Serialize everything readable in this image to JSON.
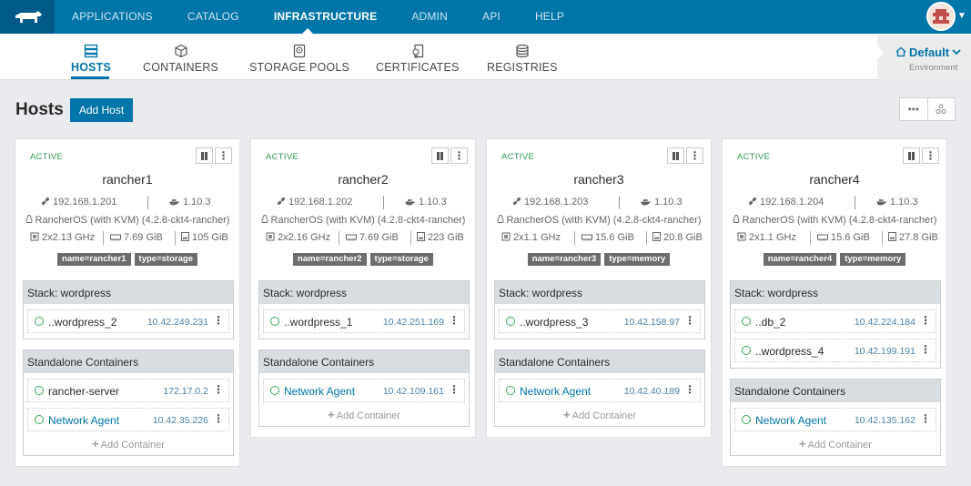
{
  "topnav": {
    "items": [
      "APPLICATIONS",
      "CATALOG",
      "INFRASTRUCTURE",
      "ADMIN",
      "API",
      "HELP"
    ],
    "active": "INFRASTRUCTURE"
  },
  "subnav": {
    "items": [
      "HOSTS",
      "CONTAINERS",
      "STORAGE POOLS",
      "CERTIFICATES",
      "REGISTRIES"
    ],
    "active": "HOSTS"
  },
  "environment": {
    "name": "Default",
    "caption": "Environment"
  },
  "page": {
    "title": "Hosts",
    "add_button": "Add Host"
  },
  "hosts": [
    {
      "state": "ACTIVE",
      "name": "rancher1",
      "ip": "192.168.1.201",
      "docker": "1.10.3",
      "os": "RancherOS (with KVM) (4.2.8-ckt4-rancher)",
      "cpu": "2x2.13 GHz",
      "memory": "7.69 GiB",
      "storage": "105 GiB",
      "labels": [
        "name=rancher1",
        "type=storage"
      ],
      "stack": {
        "title": "Stack: wordpress",
        "containers": [
          {
            "name": "..wordpress_2",
            "ip": "10.42.249.231"
          }
        ]
      },
      "standalone": {
        "title": "Standalone Containers",
        "containers": [
          {
            "name": "rancher-server",
            "ip": "172.17.0.2"
          },
          {
            "name": "Network Agent",
            "ip": "10.42.35.226"
          }
        ],
        "add_label": "Add Container"
      }
    },
    {
      "state": "ACTIVE",
      "name": "rancher2",
      "ip": "192.168.1.202",
      "docker": "1.10.3",
      "os": "RancherOS (with KVM) (4.2.8-ckt4-rancher)",
      "cpu": "2x2.16 GHz",
      "memory": "7.69 GiB",
      "storage": "223 GiB",
      "labels": [
        "name=rancher2",
        "type=storage"
      ],
      "stack": {
        "title": "Stack: wordpress",
        "containers": [
          {
            "name": "..wordpress_1",
            "ip": "10.42.251.169"
          }
        ]
      },
      "standalone": {
        "title": "Standalone Containers",
        "containers": [
          {
            "name": "Network Agent",
            "ip": "10.42.109.161"
          }
        ],
        "add_label": "Add Container"
      }
    },
    {
      "state": "ACTIVE",
      "name": "rancher3",
      "ip": "192.168.1.203",
      "docker": "1.10.3",
      "os": "RancherOS (with KVM) (4.2.8-ckt4-rancher)",
      "cpu": "2x1.1 GHz",
      "memory": "15.6 GiB",
      "storage": "20.8 GiB",
      "labels": [
        "name=rancher3",
        "type=memory"
      ],
      "stack": {
        "title": "Stack: wordpress",
        "containers": [
          {
            "name": "..wordpress_3",
            "ip": "10.42.158.97"
          }
        ]
      },
      "standalone": {
        "title": "Standalone Containers",
        "containers": [
          {
            "name": "Network Agent",
            "ip": "10.42.40.189"
          }
        ],
        "add_label": "Add Container"
      }
    },
    {
      "state": "ACTIVE",
      "name": "rancher4",
      "ip": "192.168.1.204",
      "docker": "1.10.3",
      "os": "RancherOS (with KVM) (4.2.8-ckt4-rancher)",
      "cpu": "2x1.1 GHz",
      "memory": "15.6 GiB",
      "storage": "27.8 GiB",
      "labels": [
        "name=rancher4",
        "type=memory"
      ],
      "stack": {
        "title": "Stack: wordpress",
        "containers": [
          {
            "name": "..db_2",
            "ip": "10.42.224.184"
          },
          {
            "name": "..wordpress_4",
            "ip": "10.42.199.191"
          }
        ]
      },
      "standalone": {
        "title": "Standalone Containers",
        "containers": [
          {
            "name": "Network Agent",
            "ip": "10.42.135.162"
          }
        ],
        "add_label": "Add Container"
      }
    }
  ],
  "colors": {
    "brand": "#0075a8",
    "active_state": "#2d9a4d",
    "label_bg": "#6d6d6d"
  }
}
